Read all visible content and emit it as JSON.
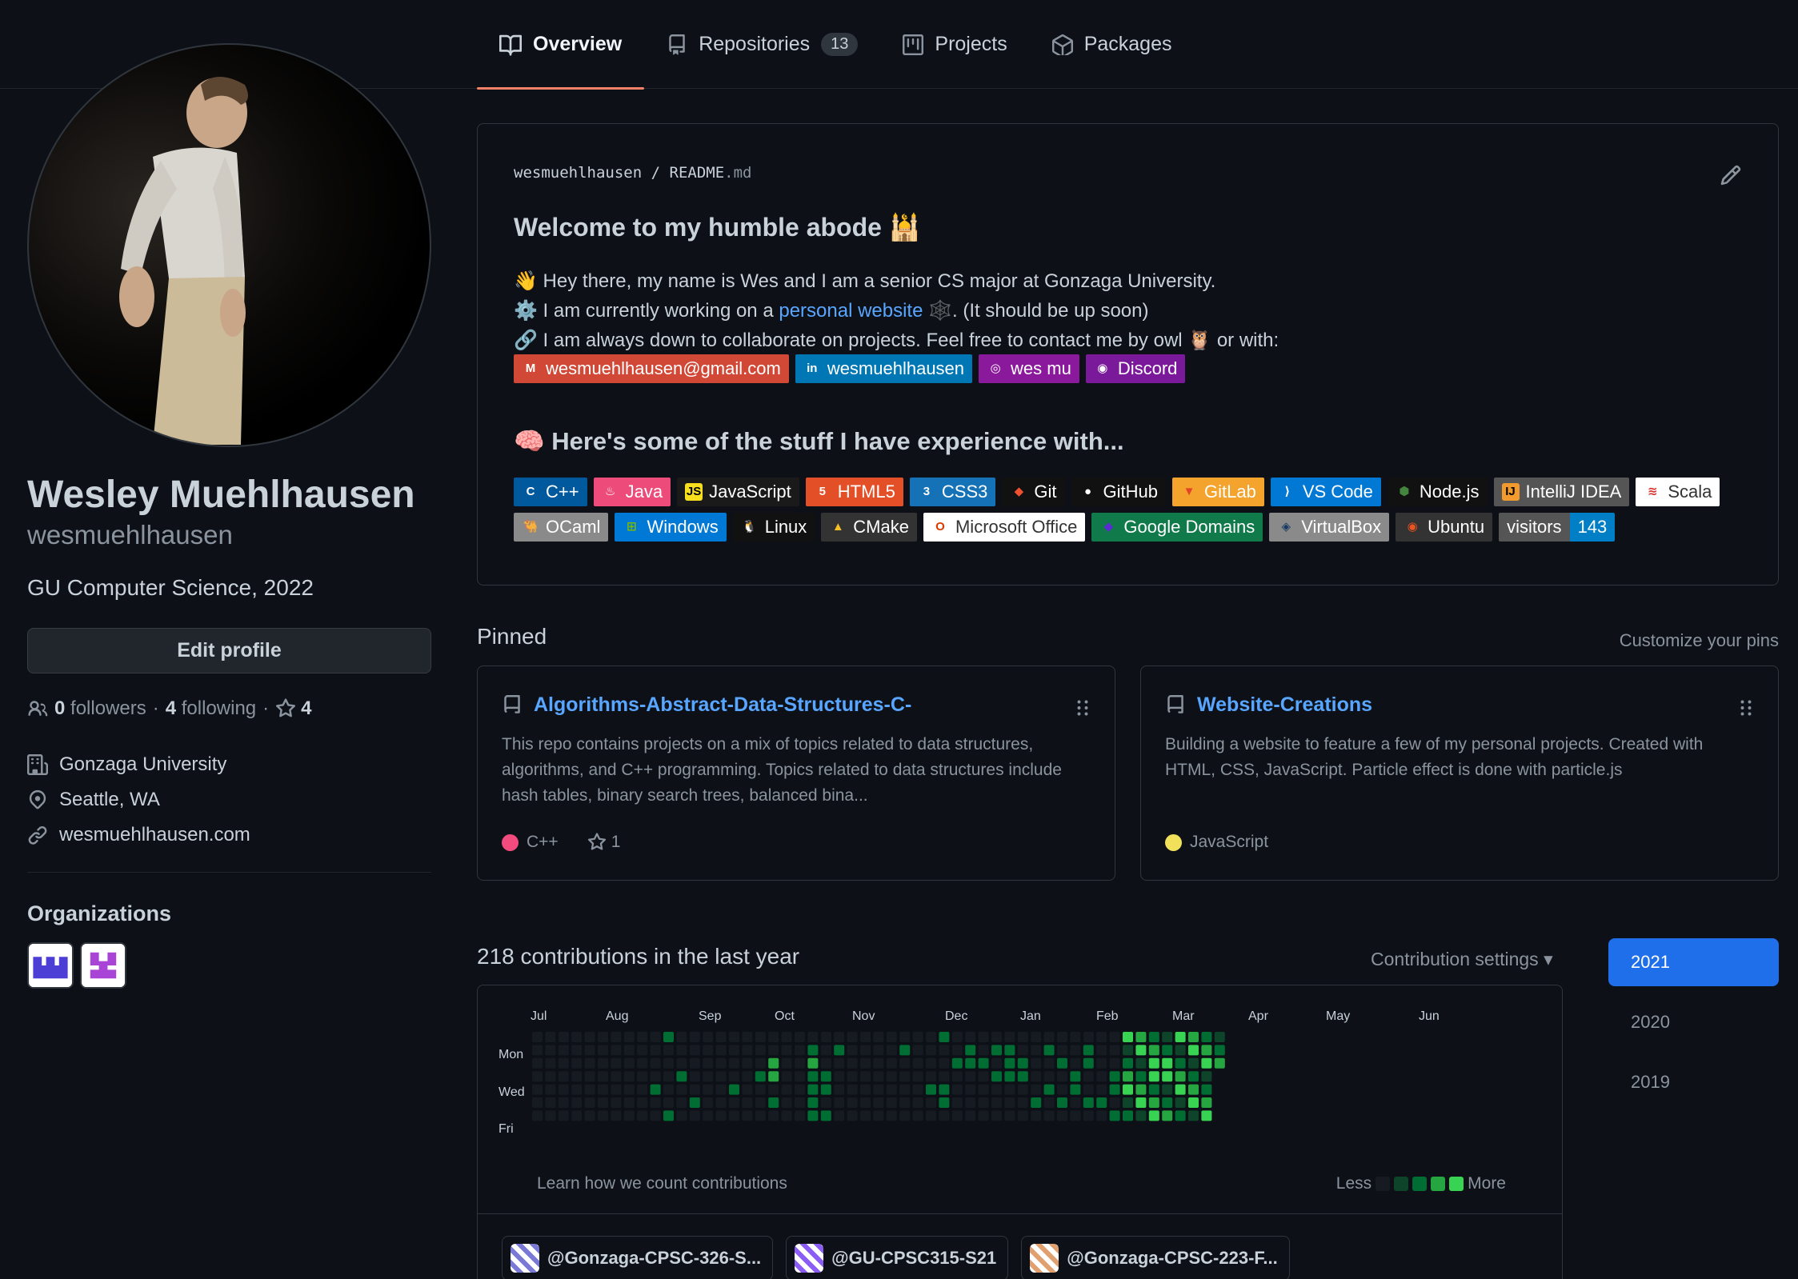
{
  "tabs": [
    {
      "label": "Overview",
      "icon": "book-icon"
    },
    {
      "label": "Repositories",
      "count": "13",
      "icon": "repo-icon"
    },
    {
      "label": "Projects",
      "icon": "project-icon"
    },
    {
      "label": "Packages",
      "icon": "package-icon"
    }
  ],
  "profile": {
    "fullname": "Wesley Muehlhausen",
    "username": "wesmuehlhausen",
    "bio": "GU Computer Science, 2022",
    "edit_label": "Edit profile",
    "status_emoji": "🎯",
    "followers_count": "0",
    "followers_label": "followers",
    "following_count": "4",
    "following_label": "following",
    "stars_count": "4",
    "sep": "·",
    "company": "Gonzaga University",
    "location": "Seattle, WA",
    "website": "wesmuehlhausen.com",
    "orgs_title": "Organizations"
  },
  "readme": {
    "path_user": "wesmuehlhausen",
    "path_sep": "/",
    "path_file": "README",
    "path_ext": ".md",
    "welcome": "Welcome to my humble abode 🕌",
    "line1": "👋 Hey there, my name is Wes and I am a senior CS major at Gonzaga University.",
    "line2_pre": "⚙️ I am currently working on a ",
    "line2_link": "personal website",
    "line2_post": " 🕸️. (It should be up soon)",
    "line3": "🔗 I am always down to collaborate on projects. Feel free to contact me by owl 🦉 or with:",
    "experience": "🧠 Here's some of the stuff I have experience with..."
  },
  "contacts": [
    {
      "label": "wesmuehlhausen@gmail.com",
      "bg": "#D14836",
      "icon": "M"
    },
    {
      "label": "wesmuehlhausen",
      "bg": "#0077B5",
      "icon": "in"
    },
    {
      "label": "wes mu",
      "bg": "#8a1a9b",
      "icon": "◎"
    },
    {
      "label": "Discord",
      "bg": "#7a1a9b",
      "icon": "◉"
    }
  ],
  "badges": [
    {
      "label": "C++",
      "bg": "#00599C",
      "icon": "C"
    },
    {
      "label": "Java",
      "bg": "#ED4C7A",
      "icon": "♨"
    },
    {
      "label": "JavaScript",
      "bg": "#1a1a1a",
      "icon": "JS",
      "iconBg": "#F7DF1E",
      "iconColor": "#000"
    },
    {
      "label": "HTML5",
      "bg": "#E34F26",
      "icon": "5"
    },
    {
      "label": "CSS3",
      "bg": "#1572B6",
      "icon": "3"
    },
    {
      "label": "Git",
      "bg": "#111111",
      "icon": "◆",
      "iconColor": "#F05032"
    },
    {
      "label": "GitHub",
      "bg": "#111111",
      "icon": "●"
    },
    {
      "label": "GitLab",
      "bg": "#F4A32C",
      "icon": "▼",
      "iconColor": "#E24329"
    },
    {
      "label": "VS Code",
      "bg": "#0078D4",
      "icon": "⟩"
    },
    {
      "label": "Node.js",
      "bg": "#111111",
      "icon": "⬢",
      "iconColor": "#43853D"
    },
    {
      "label": "IntelliJ IDEA",
      "bg": "#555555",
      "icon": "IJ",
      "iconBg": "#F29A2E",
      "iconColor": "#000"
    },
    {
      "label": "Scala",
      "bg": "#ffffff",
      "icon": "≋",
      "iconColor": "#DC322F",
      "textColor": "#333333"
    },
    {
      "label": "OCaml",
      "bg": "#8a8a8a",
      "icon": "🐫",
      "iconColor": "#EC6813"
    },
    {
      "label": "Windows",
      "bg": "#0078D6",
      "icon": "⊞",
      "iconColor": "#7FBA00"
    },
    {
      "label": "Linux",
      "bg": "#111111",
      "icon": "🐧"
    },
    {
      "label": "CMake",
      "bg": "#333333",
      "icon": "▲",
      "iconColor": "#F5C026"
    },
    {
      "label": "Microsoft Office",
      "bg": "#ffffff",
      "icon": "O",
      "iconColor": "#D83B01",
      "textColor": "#333333"
    },
    {
      "label": "Google Domains",
      "bg": "#107a4a",
      "icon": "◆",
      "iconColor": "#5d2bd6"
    },
    {
      "label": "VirtualBox",
      "bg": "#8a8a8a",
      "icon": "◈",
      "iconColor": "#183A61"
    },
    {
      "label": "Ubuntu",
      "bg": "#333333",
      "icon": "◉",
      "iconColor": "#E95420"
    }
  ],
  "visitors": {
    "label": "visitors",
    "count": "143"
  },
  "pinned": {
    "title": "Pinned",
    "customize": "Customize your pins",
    "items": [
      {
        "name": "Algorithms-Abstract-Data-Structures-C-",
        "desc": "This repo contains projects on a mix of topics related to data structures, algorithms, and C++ programming. Topics related to data structures include hash tables, binary search trees, balanced bina...",
        "lang": "C++",
        "color": "#f34b7d",
        "stars": "1"
      },
      {
        "name": "Website-Creations",
        "desc": "Building a website to feature a few of my personal projects. Created with HTML, CSS, JavaScript. Particle effect is done with particle.js",
        "lang": "JavaScript",
        "color": "#f1e05a",
        "stars": ""
      }
    ]
  },
  "contrib": {
    "title": "218 contributions in the last year",
    "settings": "Contribution settings ▾",
    "months": [
      "Jul",
      "Aug",
      "Sep",
      "Oct",
      "Nov",
      "Dec",
      "Jan",
      "Feb",
      "Mar",
      "Apr",
      "May",
      "Jun"
    ],
    "days": [
      "Mon",
      "Wed",
      "Fri"
    ],
    "learn": "Learn how we count contributions",
    "less": "Less",
    "more": "More",
    "colors": [
      "#161b22",
      "#0e4429",
      "#006d32",
      "#26a641",
      "#39d353"
    ]
  },
  "org_chips": [
    {
      "label": "@Gonzaga-CPSC-326-S..."
    },
    {
      "label": "@GU-CPSC315-S21"
    },
    {
      "label": "@Gonzaga-CPSC-223-F..."
    }
  ],
  "years": [
    "2021",
    "2020",
    "2019"
  ]
}
